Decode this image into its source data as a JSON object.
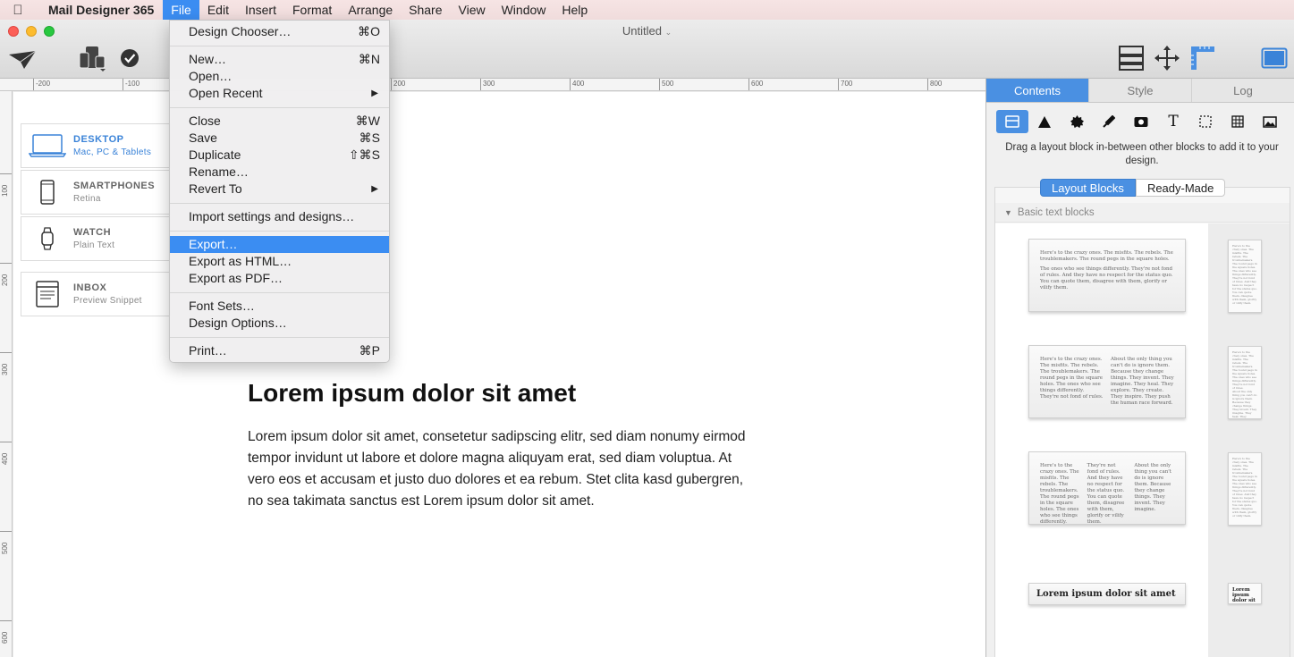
{
  "menubar": {
    "app_name": "Mail Designer 365",
    "items": [
      "File",
      "Edit",
      "Insert",
      "Format",
      "Arrange",
      "Share",
      "View",
      "Window",
      "Help"
    ]
  },
  "window": {
    "title": "Untitled"
  },
  "rulers": {
    "h_labels": [
      "-200",
      "-100",
      "200",
      "300",
      "400",
      "500",
      "600",
      "700",
      "800"
    ],
    "v_labels": [
      "100",
      "200",
      "300",
      "400",
      "500",
      "600"
    ]
  },
  "devices": [
    {
      "title": "DESKTOP",
      "subtitle": "Mac, PC & Tablets"
    },
    {
      "title": "SMARTPHONES",
      "subtitle": "Retina"
    },
    {
      "title": "WATCH",
      "subtitle": "Plain Text"
    },
    {
      "title": "INBOX",
      "subtitle": "Preview Snippet"
    }
  ],
  "canvas": {
    "headline": "Lorem ipsum dolor sit amet",
    "body": "Lorem ipsum dolor sit amet, consetetur sadipscing elitr, sed diam nonumy eirmod tempor invidunt ut labore et dolore magna aliquyam erat, sed diam voluptua. At vero eos et accusam et justo duo dolores et ea rebum. Stet clita kasd gubergren, no sea takimata sanctus est Lorem ipsum dolor sit amet."
  },
  "file_menu": {
    "items": [
      {
        "label": "Design Chooser…",
        "shortcut": "⌘O"
      },
      {
        "label": "New…",
        "shortcut": "⌘N"
      },
      {
        "label": "Open…",
        "shortcut": ""
      },
      {
        "label": "Open Recent",
        "shortcut": ""
      },
      {
        "label": "Close",
        "shortcut": "⌘W"
      },
      {
        "label": "Save",
        "shortcut": "⌘S"
      },
      {
        "label": "Duplicate",
        "shortcut": "⇧⌘S"
      },
      {
        "label": "Rename…",
        "shortcut": ""
      },
      {
        "label": "Revert To",
        "shortcut": ""
      },
      {
        "label": "Import settings and designs…",
        "shortcut": ""
      },
      {
        "label": "Export…",
        "shortcut": ""
      },
      {
        "label": "Export as HTML…",
        "shortcut": ""
      },
      {
        "label": "Export as PDF…",
        "shortcut": ""
      },
      {
        "label": "Font Sets…",
        "shortcut": ""
      },
      {
        "label": "Design Options…",
        "shortcut": ""
      },
      {
        "label": "Print…",
        "shortcut": "⌘P"
      }
    ],
    "highlighted": "Export…"
  },
  "panel": {
    "tabs": [
      "Contents",
      "Style",
      "Log"
    ],
    "active_tab": "Contents",
    "hint": "Drag a layout block in-between other blocks to add it to your design.",
    "segments": [
      "Layout Blocks",
      "Ready-Made"
    ],
    "section": "Basic text blocks",
    "block_text": {
      "one_col_a": "Here's to the crazy ones. The misfits. The rebels. The troublemakers. The round pegs in the square holes.",
      "one_col_b": "The ones who see things differently. They're not fond of rules. And they have no respect for the status quo. You can quote them, disagree with them, glorify or vilify them.",
      "two_col_left": "Here's to the crazy ones. The misfits. The rebels. The troublemakers. The round pegs in the square holes. The ones who see things differently. They're not fond of rules.",
      "two_col_right": "About the only thing you can't do is ignore them. Because they change things. They invent. They imagine. They heal. They explore. They create. They inspire. They push the human race forward.",
      "three_col_1": "Here's to the crazy ones. The misfits. The rebels. The troublemakers. The round pegs in the square holes. The ones who see things differently.",
      "three_col_2": "They're not fond of rules. And they have no respect for the status quo. You can quote them, disagree with them, glorify or vilify them.",
      "three_col_3": "About the only thing you can't do is ignore them. Because they change things. They invent. They imagine.",
      "title_block": "Lorem ipsum dolor sit amet",
      "mini_title": "Lorem ipsum dolor sit amet"
    }
  },
  "colors": {
    "accent": "#4a90e2",
    "menu_highlight": "#3b8df2"
  }
}
